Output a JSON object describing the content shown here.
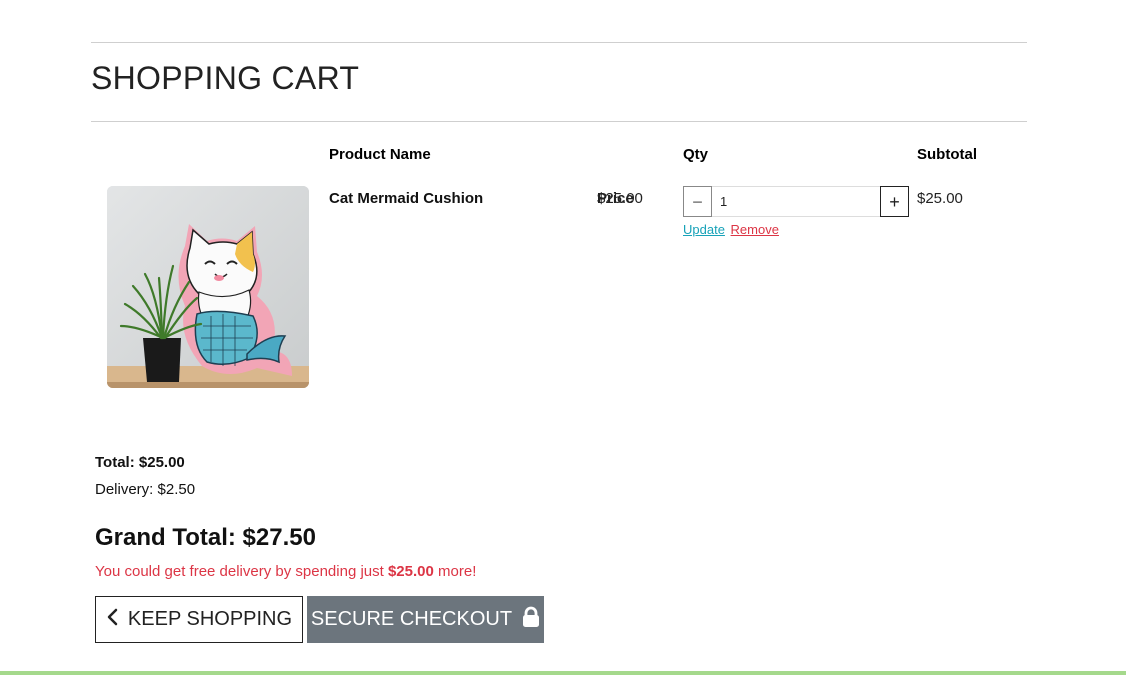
{
  "header": {
    "title": "SHOPPING CART"
  },
  "table": {
    "headers": {
      "product_name": "Product Name",
      "price": "Price",
      "qty": "Qty",
      "subtotal": "Subtotal"
    },
    "items": [
      {
        "name": "Cat Mermaid Cushion",
        "price": "$25.00",
        "qty": "1",
        "subtotal": "$25.00",
        "image_alt": "Cat Mermaid Cushion"
      }
    ],
    "actions": {
      "update": "Update",
      "remove": "Remove"
    },
    "qty_controls": {
      "minus": "−",
      "plus": "+"
    }
  },
  "summary": {
    "total": "Total: $25.00",
    "delivery": "Delivery: $2.50",
    "grand_total": "Grand Total: $27.50",
    "free_delivery_prefix": "You could get free delivery by spending just ",
    "free_delivery_amount": "$25.00",
    "free_delivery_suffix": " more!"
  },
  "buttons": {
    "keep_shopping": "KEEP SHOPPING",
    "secure_checkout": "SECURE CHECKOUT"
  },
  "colors": {
    "accent_link": "#17a2b8",
    "danger": "#dc3545",
    "checkout_bg": "#6c757d",
    "footer_bar": "#a5d98c"
  },
  "icons": {
    "keep_shopping": "chevron-left-icon",
    "secure_checkout": "lock-icon"
  }
}
